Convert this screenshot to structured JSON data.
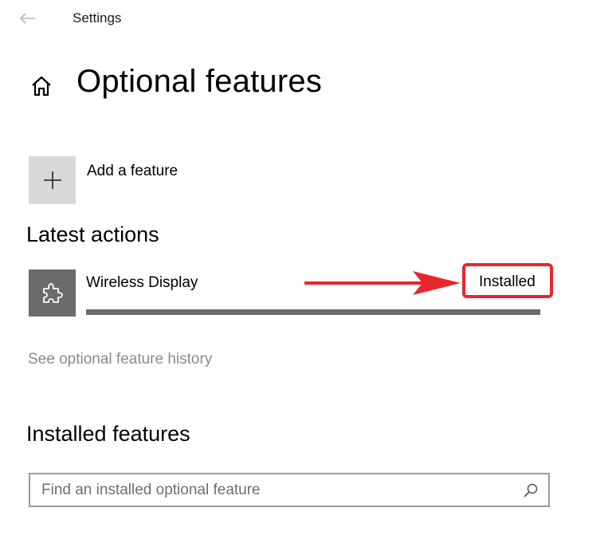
{
  "window": {
    "title": "Settings"
  },
  "page": {
    "title": "Optional features"
  },
  "add_feature": {
    "label": "Add a feature",
    "icon": "plus-icon"
  },
  "latest_actions": {
    "heading": "Latest actions",
    "items": [
      {
        "name": "Wireless Display",
        "status": "Installed",
        "icon": "puzzle-piece-icon",
        "progress_percent": 100
      }
    ]
  },
  "history_link": {
    "label": "See optional feature history"
  },
  "installed_features": {
    "heading": "Installed features",
    "search": {
      "placeholder": "Find an installed optional feature",
      "value": ""
    }
  },
  "icons": {
    "back": "back-arrow-icon",
    "home": "home-icon",
    "search": "search-icon"
  },
  "colors": {
    "tile_add": "#d8d8d8",
    "tile_feature": "#6d6a6a",
    "progress_fill": "#6d6a6a",
    "annotation_red": "#e8262e",
    "link_gray": "#8a8a8a"
  }
}
